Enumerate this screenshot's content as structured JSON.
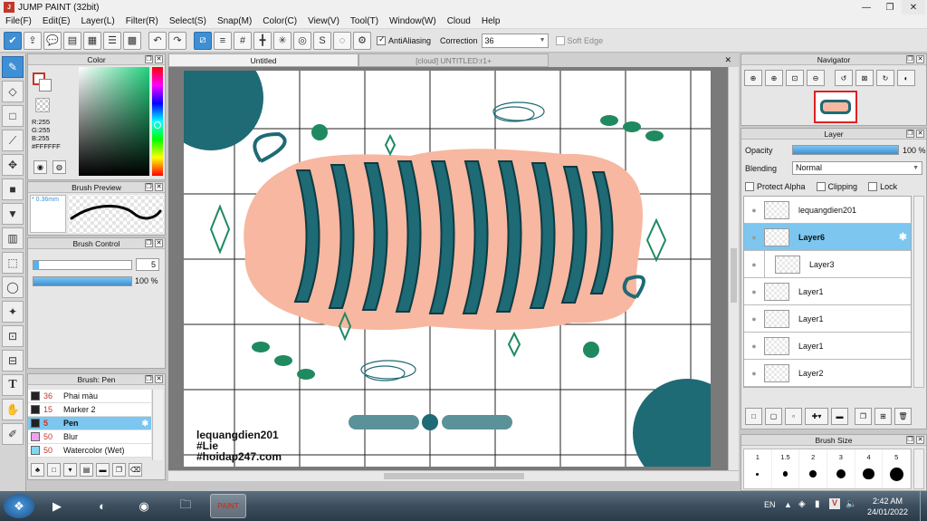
{
  "window": {
    "title": "JUMP PAINT (32bit)"
  },
  "menu": [
    "File(F)",
    "Edit(E)",
    "Layer(L)",
    "Filter(R)",
    "Select(S)",
    "Snap(M)",
    "Color(C)",
    "View(V)",
    "Tool(T)",
    "Window(W)",
    "Cloud",
    "Help"
  ],
  "toolbar": {
    "antialiasing_label": "AntiAliasing",
    "correction_label": "Correction",
    "correction_value": "36",
    "soft_edge_label": "Soft Edge"
  },
  "color_panel": {
    "title": "Color",
    "r": "R:255",
    "g": "G:255",
    "b": "B:255",
    "hex": "#FFFFFF"
  },
  "brush_preview": {
    "title": "Brush Preview",
    "size": "0.36mm"
  },
  "brush_control": {
    "title": "Brush Control",
    "size_value": "5",
    "opacity_value": "100 %",
    "opacity": 1.0
  },
  "brush_list": {
    "title": "Brush: Pen",
    "items": [
      {
        "size": "36",
        "name": "Phai màu",
        "color": "#222222"
      },
      {
        "size": "15",
        "name": "Marker 2",
        "color": "#222222"
      },
      {
        "size": "5",
        "name": "Pen",
        "color": "#222222"
      },
      {
        "size": "50",
        "name": "Blur",
        "color": "#f0a0f0"
      },
      {
        "size": "50",
        "name": "Watercolor (Wet)",
        "color": "#7fd8f0"
      }
    ]
  },
  "tabs": [
    "Untitled",
    "[cloud] UNTITLED:r1+"
  ],
  "artwork": {
    "credit_lines": [
      "lequangdien201",
      "#Lie",
      "#hoidap247.com"
    ]
  },
  "navigator": {
    "title": "Navigator"
  },
  "layer_panel": {
    "title": "Layer",
    "opacity_label": "Opacity",
    "opacity_value": "100 %",
    "opacity": 1.0,
    "blending_label": "Blending",
    "blending_value": "Normal",
    "protect_alpha_label": "Protect Alpha",
    "clipping_label": "Clipping",
    "lock_label": "Lock",
    "layers": [
      {
        "name": "lequangdien201",
        "selected": false,
        "indent": false
      },
      {
        "name": "Layer6",
        "selected": true,
        "indent": false
      },
      {
        "name": "Layer3",
        "selected": false,
        "indent": true
      },
      {
        "name": "Layer1",
        "selected": false,
        "indent": false
      },
      {
        "name": "Layer1",
        "selected": false,
        "indent": false
      },
      {
        "name": "Layer1",
        "selected": false,
        "indent": false
      },
      {
        "name": "Layer2",
        "selected": false,
        "indent": false
      }
    ]
  },
  "brush_size_panel": {
    "title": "Brush Size",
    "sizes": [
      "1",
      "1.5",
      "2",
      "3",
      "4",
      "5"
    ]
  },
  "taskbar": {
    "language": "EN",
    "time": "2:42 AM",
    "date": "24/01/2022"
  },
  "colors": {
    "accent": "#3f8fd6",
    "selection": "#7cc6ef",
    "teal": "#1e6a75",
    "peach": "#f7b7a0",
    "green": "#1f8a60"
  }
}
